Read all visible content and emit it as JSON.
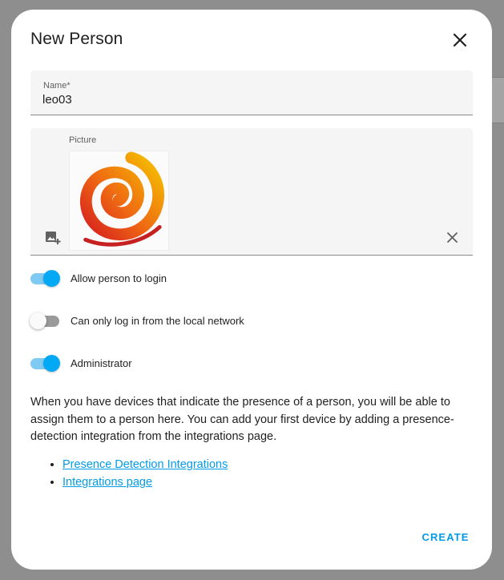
{
  "dialog": {
    "title": "New Person",
    "close_icon": "close-icon"
  },
  "name_field": {
    "label": "Name*",
    "value": "leo03"
  },
  "picture_field": {
    "label": "Picture",
    "add_icon": "add-photo-icon",
    "clear_icon": "clear-icon"
  },
  "toggles": [
    {
      "label": "Allow person to login",
      "checked": true
    },
    {
      "label": "Can only log in from the local network",
      "checked": false
    },
    {
      "label": "Administrator",
      "checked": true
    }
  ],
  "description": "When you have devices that indicate the presence of a person, you will be able to assign them to a person here. You can add your first device by adding a presence-detection integration from the integrations page.",
  "links": [
    {
      "label": "Presence Detection Integrations"
    },
    {
      "label": "Integrations page"
    }
  ],
  "actions": {
    "create_label": "CREATE"
  },
  "colors": {
    "accent": "#03a9f4",
    "link": "#039be5"
  }
}
